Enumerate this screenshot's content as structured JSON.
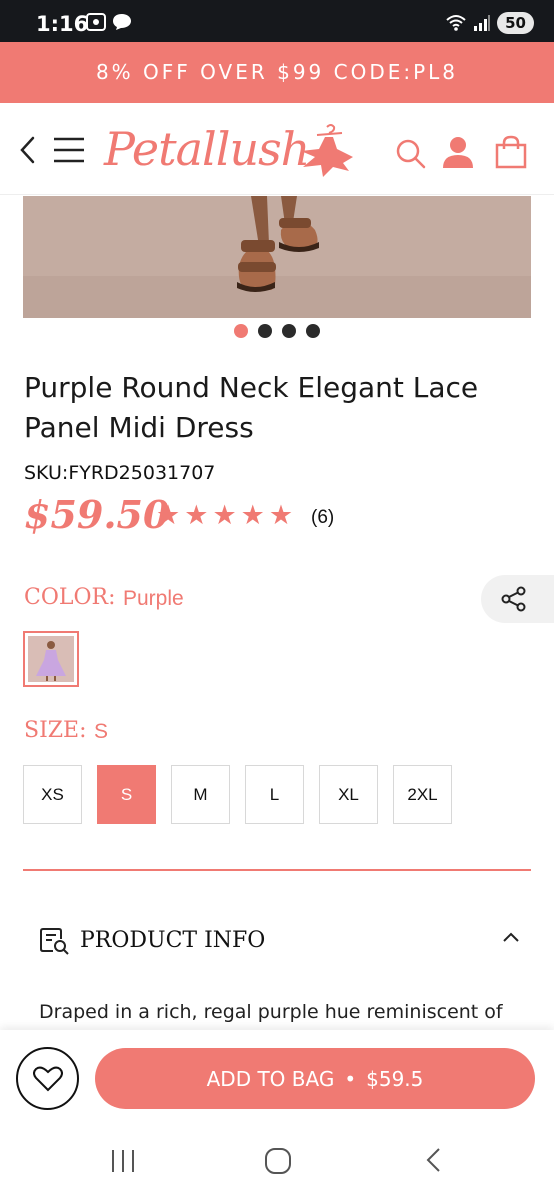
{
  "status_bar": {
    "time": "1:16",
    "battery": "50"
  },
  "promo": {
    "text": "8% OFF OVER $99 CODE:PL8"
  },
  "header": {
    "logo_text": "Petallush",
    "back_icon": "back-arrow-icon",
    "menu_icon": "hamburger-menu-icon",
    "search_icon": "search-icon",
    "account_icon": "user-icon",
    "bag_icon": "shopping-bag-icon"
  },
  "carousel": {
    "total": 4,
    "active_index": 0
  },
  "product": {
    "title": "Purple Round Neck Elegant Lace Panel Midi Dress",
    "sku": "SKU:FYRD25031707",
    "price": "$59.50",
    "rating": 5,
    "review_count": "(6)"
  },
  "color": {
    "label": "COLOR:",
    "value": "Purple"
  },
  "size": {
    "label": "SIZE:",
    "value": "S",
    "options": [
      "XS",
      "S",
      "M",
      "L",
      "XL",
      "2XL"
    ],
    "selected": "S"
  },
  "product_info": {
    "title": "PRODUCT INFO",
    "description": "Draped in a rich, regal purple hue reminiscent of"
  },
  "bottom_bar": {
    "add_to_bag_label": "ADD TO BAG",
    "separator": "•",
    "price": "$59.5"
  },
  "colors": {
    "accent": "#f07a73",
    "dark": "#16181c"
  }
}
